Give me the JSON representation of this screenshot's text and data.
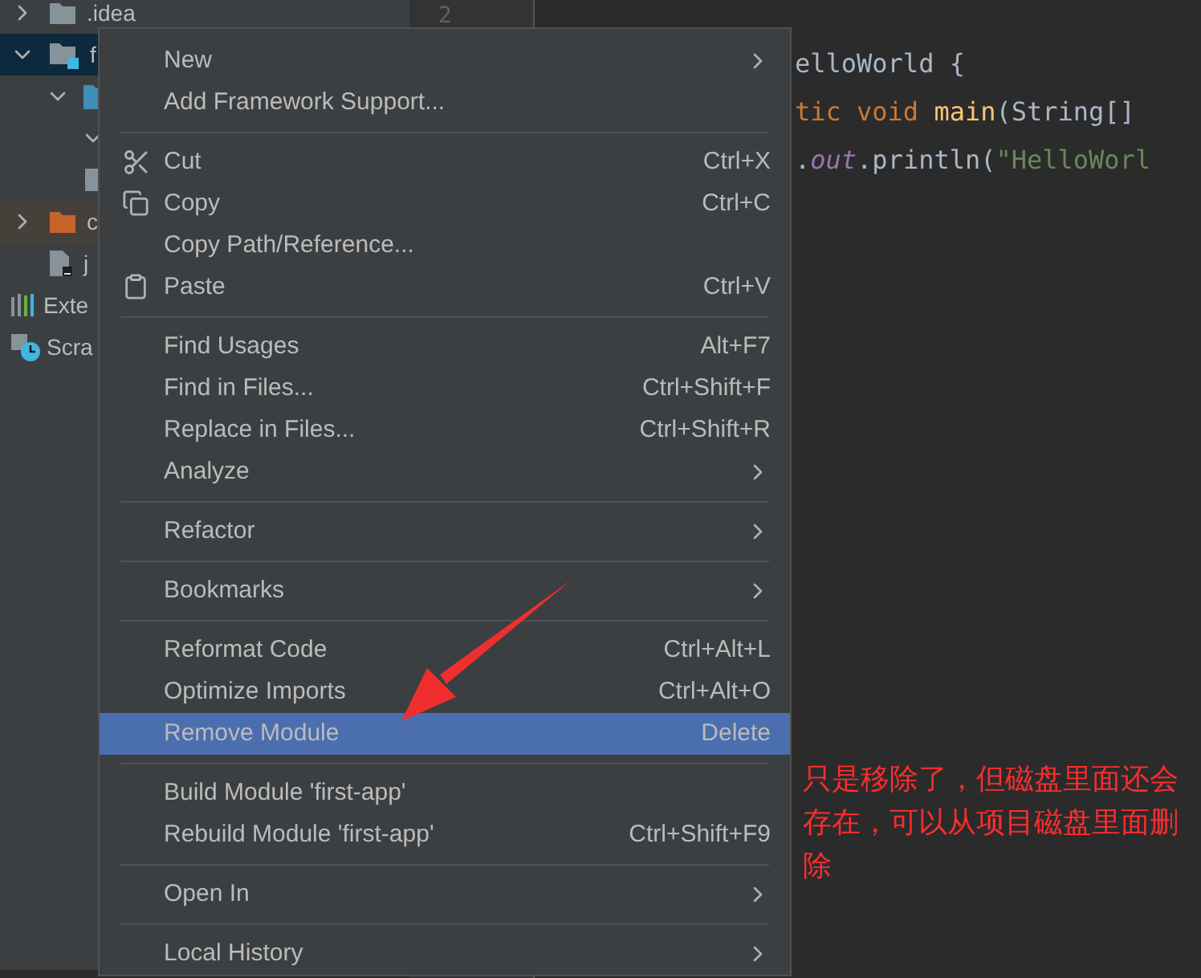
{
  "project_tree": [
    {
      "label": ".idea",
      "kind": "folder",
      "expanded": false,
      "selected": false
    },
    {
      "label": "f",
      "kind": "module",
      "expanded": true,
      "selected": true,
      "children": [
        {
          "kind": "source",
          "expanded": true,
          "selected": false,
          "children": [
            {
              "expanded": true,
              "selected": false
            }
          ]
        },
        {
          "kind": "file",
          "selected": false
        }
      ]
    },
    {
      "label": "c",
      "kind": "output",
      "expanded": false,
      "selected": false
    },
    {
      "label": "j",
      "kind": "iml",
      "selected": false
    },
    {
      "label": "Exte",
      "kind": "libraries",
      "selected": false
    },
    {
      "label": "Scra",
      "kind": "scratches",
      "selected": false
    }
  ],
  "gutter": {
    "line_number": "2"
  },
  "editor_lines": [
    [
      {
        "text": "elloWorld {",
        "kind": "plain"
      }
    ],
    [
      {
        "text": "tic void ",
        "kind": "keyword"
      },
      {
        "text": "main",
        "kind": "method"
      },
      {
        "text": "(String[]",
        "kind": "plain"
      }
    ],
    [
      {
        "text": ".",
        "kind": "plain"
      },
      {
        "text": "out",
        "kind": "field"
      },
      {
        "text": ".println(",
        "kind": "plain"
      },
      {
        "text": "\"HelloWorl",
        "kind": "string"
      }
    ]
  ],
  "context_menu": [
    [
      {
        "label": "New",
        "submenu": true,
        "selected": false
      },
      {
        "label": "Add Framework Support...",
        "selected": false
      }
    ],
    [
      {
        "label": "Cut",
        "kind": "scissors",
        "shortcut": "Ctrl+X",
        "selected": false
      },
      {
        "label": "Copy",
        "kind": "copy",
        "shortcut": "Ctrl+C",
        "selected": false
      },
      {
        "label": "Copy Path/Reference...",
        "selected": false
      },
      {
        "label": "Paste",
        "kind": "paste",
        "shortcut": "Ctrl+V",
        "selected": false
      }
    ],
    [
      {
        "label": "Find Usages",
        "shortcut": "Alt+F7",
        "selected": false
      },
      {
        "label": "Find in Files...",
        "shortcut": "Ctrl+Shift+F",
        "selected": false
      },
      {
        "label": "Replace in Files...",
        "shortcut": "Ctrl+Shift+R",
        "selected": false
      },
      {
        "label": "Analyze",
        "submenu": true,
        "selected": false
      }
    ],
    [
      {
        "label": "Refactor",
        "submenu": true,
        "selected": false
      }
    ],
    [
      {
        "label": "Bookmarks",
        "submenu": true,
        "selected": false
      }
    ],
    [
      {
        "label": "Reformat Code",
        "shortcut": "Ctrl+Alt+L",
        "selected": false
      },
      {
        "label": "Optimize Imports",
        "shortcut": "Ctrl+Alt+O",
        "selected": false
      },
      {
        "label": "Remove Module",
        "shortcut": "Delete",
        "selected": true
      }
    ],
    [
      {
        "label": "Build Module 'first-app'",
        "selected": false
      },
      {
        "label": "Rebuild Module 'first-app'",
        "shortcut": "Ctrl+Shift+F9",
        "selected": false
      }
    ],
    [
      {
        "label": "Open In",
        "submenu": true,
        "selected": false
      }
    ],
    [
      {
        "label": "Local History",
        "submenu": true,
        "selected": false
      }
    ]
  ],
  "annotation": {
    "text": "只是移除了，但磁盘里面还会存在，可以从项目磁盘里面删除"
  }
}
